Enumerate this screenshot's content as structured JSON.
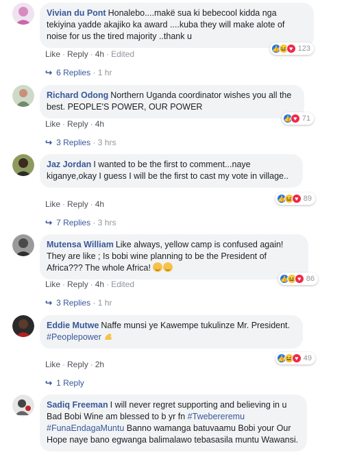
{
  "comments": [
    {
      "author": "Vivian du Pont",
      "text": "Honalebo....makë sua ki bebecool kidda nga tekiyina yadde akajiko ka award ....kuba they will make alote of noise for us the tired majority ..thank u",
      "like": "Like",
      "reply": "Reply",
      "time": "4h",
      "edited": "Edited",
      "reaction_count": "123",
      "reactions": [
        "like-icon",
        "haha-icon",
        "love-icon"
      ],
      "replies": "6 Replies",
      "replies_time": "1 hr"
    },
    {
      "author": "Richard Odong",
      "text": "Northern Uganda coordinator wishes you all the best. PEOPLE'S POWER, OUR POWER",
      "like": "Like",
      "reply": "Reply",
      "time": "4h",
      "reaction_count": "71",
      "reactions": [
        "like-icon",
        "love-icon"
      ],
      "replies": "3 Replies",
      "replies_time": "3 hrs"
    },
    {
      "author": "Jaz Jordan",
      "text": "I wanted to be the first to comment...naye kiganye,okay I guess I will be the first to cast my vote in village..",
      "like": "Like",
      "reply": "Reply",
      "time": "4h",
      "reaction_count": "89",
      "reactions": [
        "like-icon",
        "haha-icon",
        "love-icon"
      ],
      "replies": "7 Replies",
      "replies_time": "3 hrs"
    },
    {
      "author": "Mutensa William",
      "text": "Like always, yellow camp is confused again! They are like ; Is bobi wine planning to be the President of Africa??? The whole Africa!",
      "like": "Like",
      "reply": "Reply",
      "time": "4h",
      "edited": "Edited",
      "reaction_count": "86",
      "reactions": [
        "like-icon",
        "haha-icon",
        "love-icon"
      ],
      "replies": "3 Replies",
      "replies_time": "1 hr"
    },
    {
      "author": "Eddie Mutwe",
      "text": "Naffe munsi ye Kawempe tukulinze Mr. President.",
      "hashtag": "#Peoplepower",
      "like": "Like",
      "reply": "Reply",
      "time": "2h",
      "reaction_count": "49",
      "reactions": [
        "like-icon",
        "haha-icon",
        "love-icon"
      ],
      "replies": "1 Reply"
    },
    {
      "author": "Sadiq Freeman",
      "text_a": "I will never regret supporting and believing in u Bad Bobi Wine am blessed to b yr fn ",
      "hashtag_a": "#Twebereremu",
      "hashtag_b": "#FunaEndagaMuntu",
      "text_b": " Banno wamanga batuvaamu Bobi your Our Hope naye bano egwanga balimalawo tebasasila muntu Wawansi."
    }
  ],
  "colors": {
    "link": "#385898",
    "bubble": "#f2f3f5",
    "like": "#1877f2",
    "love": "#f0284a",
    "haha": "#f7c24a"
  }
}
